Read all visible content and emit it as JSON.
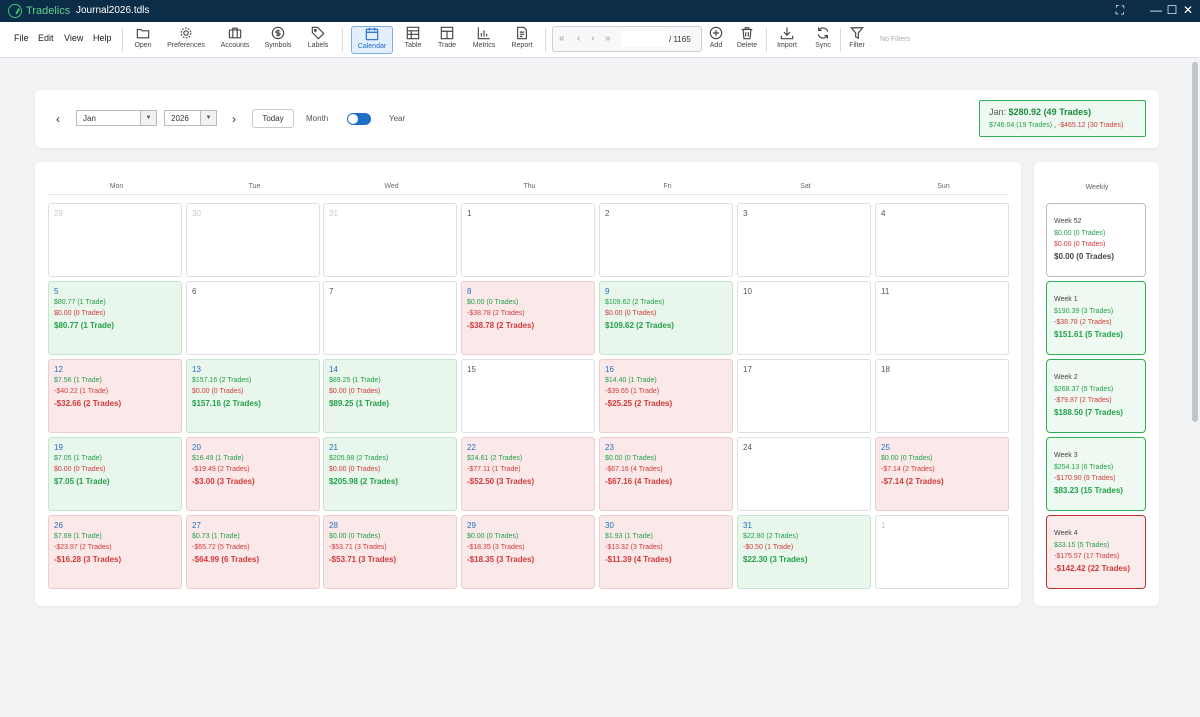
{
  "titlebar": {
    "app_name": "Tradelics",
    "file_name": "Journal2026.tdls",
    "fullscreen": "⛶",
    "minimize": "—",
    "maximize": "☐",
    "close": "✕"
  },
  "menu": [
    "File",
    "Edit",
    "View",
    "Help"
  ],
  "toolbar": [
    {
      "label": "Open",
      "icon": "folder-icon"
    },
    {
      "label": "Preferences",
      "icon": "gear-icon"
    },
    {
      "label": "Accounts",
      "icon": "briefcase-icon"
    },
    {
      "label": "Symbols",
      "icon": "dollar-icon"
    },
    {
      "label": "Labels",
      "icon": "tag-icon"
    },
    {
      "label": "Calendar",
      "icon": "calendar-icon",
      "active": true
    },
    {
      "label": "Table",
      "icon": "table-icon"
    },
    {
      "label": "Trade",
      "icon": "trade-icon"
    },
    {
      "label": "Metrics",
      "icon": "chart-icon"
    },
    {
      "label": "Report",
      "icon": "report-icon"
    },
    {
      "label": "Add",
      "icon": "plus-circle-icon"
    },
    {
      "label": "Delete",
      "icon": "trash-icon"
    },
    {
      "label": "Import",
      "icon": "download-icon"
    },
    {
      "label": "Sync",
      "icon": "sync-icon"
    },
    {
      "label": "Filter",
      "icon": "filter-icon"
    }
  ],
  "pager": {
    "first": "«",
    "prev": "‹",
    "next": "›",
    "last": "»",
    "value": "",
    "total": "/ 1165"
  },
  "filter_status": "No Filters",
  "controls": {
    "prev": "‹",
    "next": "›",
    "month": "Jan",
    "year": "2026",
    "today": "Today",
    "month_label": "Month",
    "year_label": "Year",
    "toggle": "year"
  },
  "summary": {
    "label": "Jan:",
    "total": "$280.92 (49 Trades)",
    "gain": "$746.04 (19 Trades)",
    "separator": ",",
    "loss": "-$465.12 (30 Trades)"
  },
  "colors": {
    "green": "#23a04a",
    "red": "#d23a3a",
    "accent": "#1f6fc6",
    "titlebar": "#0c2d48"
  },
  "weekdays": [
    "Mon",
    "Tue",
    "Wed",
    "Thu",
    "Fri",
    "Sat",
    "Sun"
  ],
  "weeks": [
    [
      {
        "day": "29",
        "other": true
      },
      {
        "day": "30",
        "other": true
      },
      {
        "day": "31",
        "other": true
      },
      {
        "day": "1"
      },
      {
        "day": "2"
      },
      {
        "day": "3"
      },
      {
        "day": "4"
      }
    ],
    [
      {
        "day": "5",
        "type": "pos",
        "gain": "$80.77 (1 Trade)",
        "loss": "$0.00 (0 Trades)",
        "net": "$80.77 (1 Trade)"
      },
      {
        "day": "6"
      },
      {
        "day": "7"
      },
      {
        "day": "8",
        "type": "neg",
        "gain": "$0.00 (0 Trades)",
        "loss": "-$38.78 (2 Trades)",
        "net": "-$38.78 (2 Trades)"
      },
      {
        "day": "9",
        "type": "pos",
        "gain": "$109.62 (2 Trades)",
        "loss": "$0.00 (0 Trades)",
        "net": "$109.62 (2 Trades)"
      },
      {
        "day": "10"
      },
      {
        "day": "11"
      }
    ],
    [
      {
        "day": "12",
        "type": "neg",
        "gain": "$7.56 (1 Trade)",
        "loss": "-$40.22 (1 Trade)",
        "net": "-$32.66 (2 Trades)"
      },
      {
        "day": "13",
        "type": "pos",
        "gain": "$157.16 (2 Trades)",
        "loss": "$0.00 (0 Trades)",
        "net": "$157.16 (2 Trades)"
      },
      {
        "day": "14",
        "type": "pos",
        "gain": "$89.25 (1 Trade)",
        "loss": "$0.00 (0 Trades)",
        "net": "$89.25 (1 Trade)"
      },
      {
        "day": "15"
      },
      {
        "day": "16",
        "type": "neg",
        "gain": "$14.40 (1 Trade)",
        "loss": "-$39.65 (1 Trade)",
        "net": "-$25.25 (2 Trades)"
      },
      {
        "day": "17"
      },
      {
        "day": "18"
      }
    ],
    [
      {
        "day": "19",
        "type": "pos",
        "gain": "$7.05 (1 Trade)",
        "loss": "$0.00 (0 Trades)",
        "net": "$7.05 (1 Trade)"
      },
      {
        "day": "20",
        "type": "neg",
        "gain": "$16.49 (1 Trade)",
        "loss": "-$19.49 (2 Trades)",
        "net": "-$3.00 (3 Trades)"
      },
      {
        "day": "21",
        "type": "pos",
        "gain": "$205.98 (2 Trades)",
        "loss": "$0.00 (0 Trades)",
        "net": "$205.98 (2 Trades)"
      },
      {
        "day": "22",
        "type": "neg",
        "gain": "$24.61 (2 Trades)",
        "loss": "-$77.11 (1 Trade)",
        "net": "-$52.50 (3 Trades)"
      },
      {
        "day": "23",
        "type": "neg",
        "gain": "$0.00 (0 Trades)",
        "loss": "-$67.16 (4 Trades)",
        "net": "-$67.16 (4 Trades)"
      },
      {
        "day": "24"
      },
      {
        "day": "25",
        "type": "neg",
        "gain": "$0.00 (0 Trades)",
        "loss": "-$7.14 (2 Trades)",
        "net": "-$7.14 (2 Trades)"
      }
    ],
    [
      {
        "day": "26",
        "type": "neg",
        "gain": "$7.69 (1 Trade)",
        "loss": "-$23.97 (2 Trades)",
        "net": "-$16.28 (3 Trades)"
      },
      {
        "day": "27",
        "type": "neg",
        "gain": "$0.73 (1 Trade)",
        "loss": "-$65.72 (5 Trades)",
        "net": "-$64.99 (6 Trades)"
      },
      {
        "day": "28",
        "type": "neg",
        "gain": "$0.00 (0 Trades)",
        "loss": "-$53.71 (3 Trades)",
        "net": "-$53.71 (3 Trades)"
      },
      {
        "day": "29",
        "type": "neg",
        "gain": "$0.00 (0 Trades)",
        "loss": "-$18.35 (3 Trades)",
        "net": "-$18.35 (3 Trades)"
      },
      {
        "day": "30",
        "type": "neg",
        "gain": "$1.93 (1 Trade)",
        "loss": "-$13.32 (3 Trades)",
        "net": "-$11.39 (4 Trades)"
      },
      {
        "day": "31",
        "type": "pos",
        "gain": "$22.80 (2 Trades)",
        "loss": "-$0.50 (1 Trade)",
        "net": "$22.30 (3 Trades)"
      },
      {
        "day": "1",
        "other": true
      }
    ]
  ],
  "weekly": {
    "title": "Weekly",
    "items": [
      {
        "label": "Week 52",
        "type": "zero",
        "gain": "$0.00 (0 Trades)",
        "loss": "$0.00 (0 Trades)",
        "net": "$0.00 (0 Trades)"
      },
      {
        "label": "Week 1",
        "type": "pos",
        "gain": "$190.39 (3 Trades)",
        "loss": "-$38.78 (2 Trades)",
        "net": "$151.61 (5 Trades)"
      },
      {
        "label": "Week 2",
        "type": "pos",
        "gain": "$268.37 (5 Trades)",
        "loss": "-$79.87 (2 Trades)",
        "net": "$188.50 (7 Trades)"
      },
      {
        "label": "Week 3",
        "type": "pos",
        "gain": "$254.13 (6 Trades)",
        "loss": "-$170.90 (9 Trades)",
        "net": "$83.23 (15 Trades)"
      },
      {
        "label": "Week 4",
        "type": "neg",
        "gain": "$33.15 (5 Trades)",
        "loss": "-$175.57 (17 Trades)",
        "net": "-$142.42 (22 Trades)"
      }
    ]
  }
}
